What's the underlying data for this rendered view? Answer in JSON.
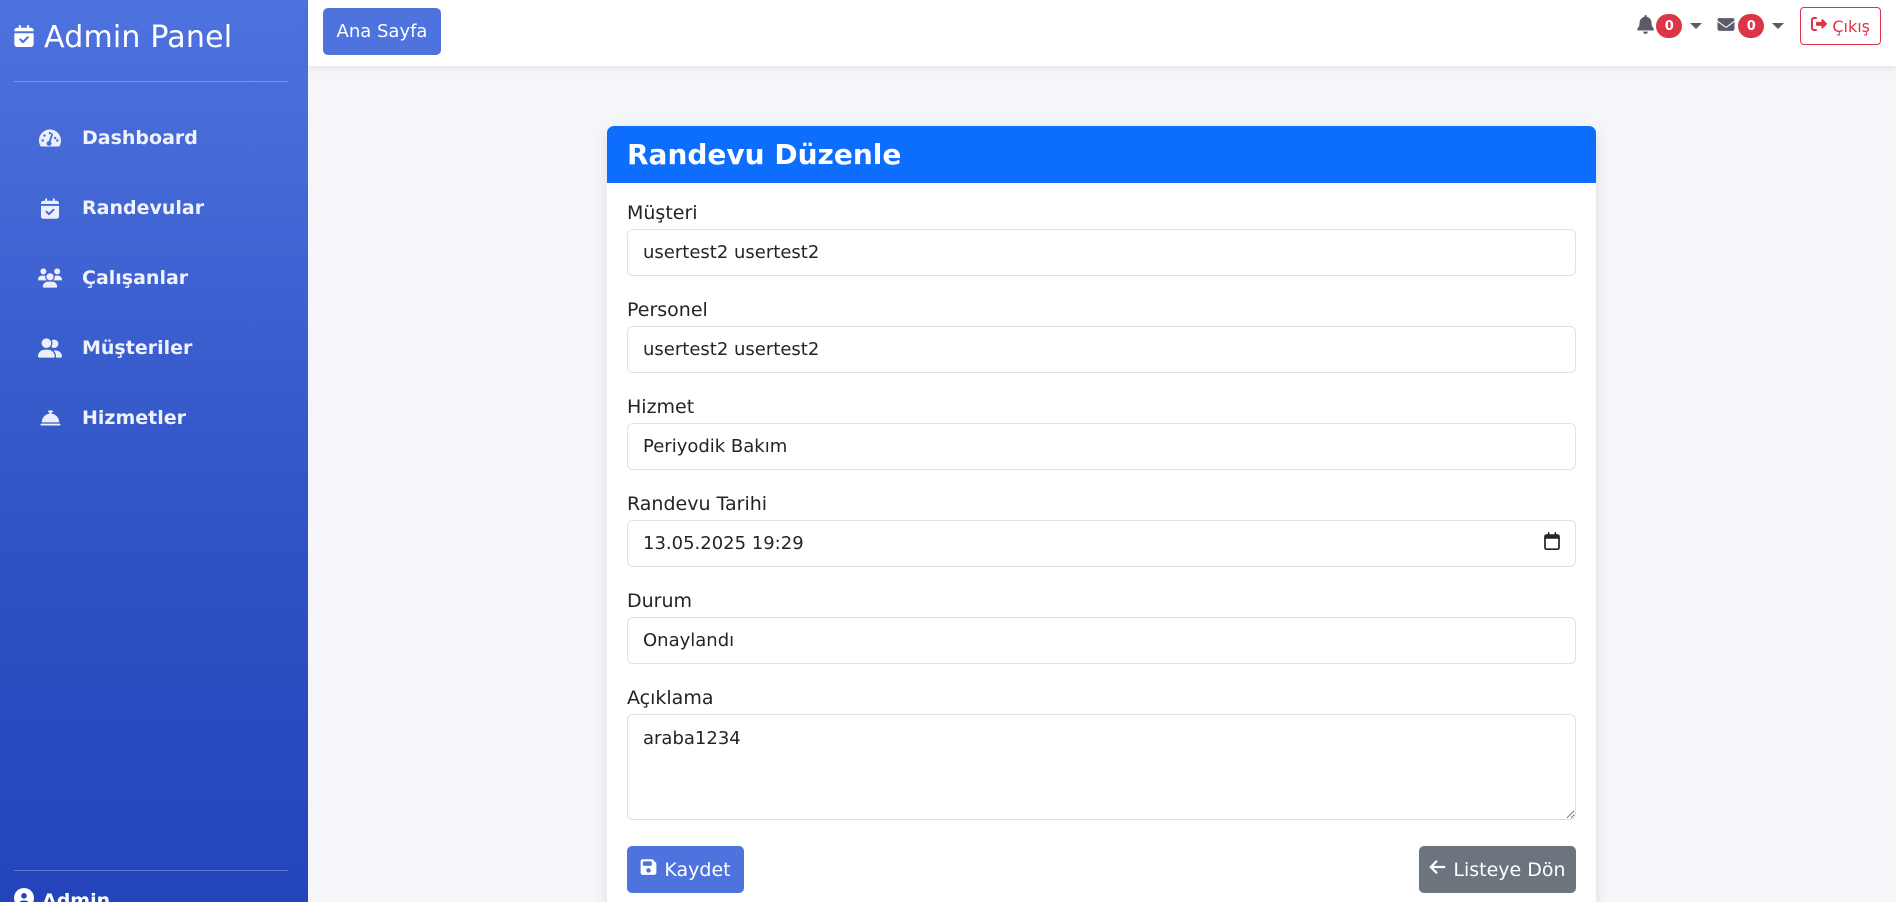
{
  "brand": {
    "title": "Admin Panel",
    "icon": "calendar-check-icon"
  },
  "sidebar": {
    "items": [
      {
        "label": "Dashboard",
        "icon": "tachometer-icon"
      },
      {
        "label": "Randevular",
        "icon": "calendar-check-icon"
      },
      {
        "label": "Çalışanlar",
        "icon": "users-icon"
      },
      {
        "label": "Müşteriler",
        "icon": "user-friends-icon"
      },
      {
        "label": "Hizmetler",
        "icon": "concierge-bell-icon"
      }
    ],
    "user_label": "Admin"
  },
  "topbar": {
    "home_button": "Ana Sayfa",
    "notifications_count": "0",
    "messages_count": "0",
    "logout_label": "Çıkış"
  },
  "form": {
    "title": "Randevu Düzenle",
    "fields": {
      "musteri": {
        "label": "Müşteri",
        "value": "usertest2 usertest2"
      },
      "personel": {
        "label": "Personel",
        "value": "usertest2 usertest2"
      },
      "hizmet": {
        "label": "Hizmet",
        "value": "Periyodik Bakım"
      },
      "tarih": {
        "label": "Randevu Tarihi",
        "value": "13.05.2025 19:29"
      },
      "durum": {
        "label": "Durum",
        "value": "Onaylandı"
      },
      "aciklama": {
        "label": "Açıklama",
        "value": "araba1234"
      }
    },
    "save_button": "Kaydet",
    "back_button": "Listeye Dön"
  },
  "colors": {
    "sidebar_top": "#4e73df",
    "sidebar_bottom": "#2444bb",
    "card_header": "#0d6efd",
    "danger": "#dc3545",
    "secondary": "#6c757d"
  }
}
